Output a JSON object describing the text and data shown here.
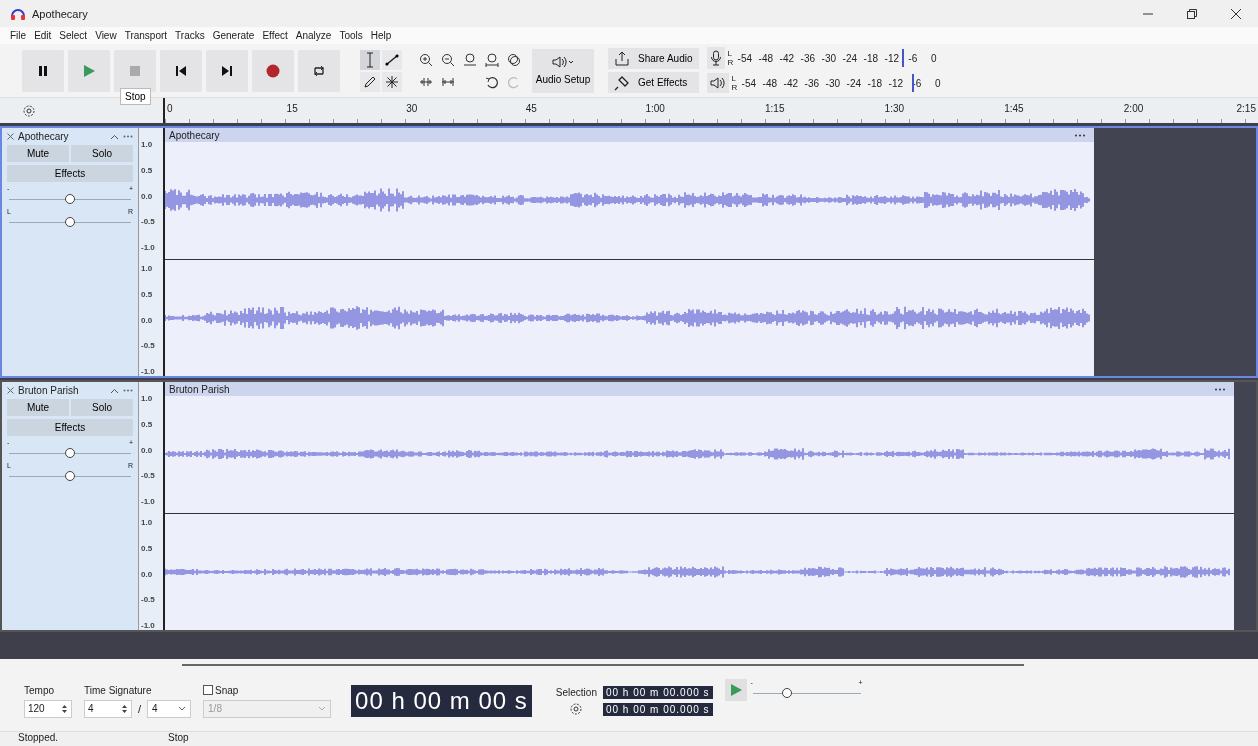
{
  "window": {
    "title": "Apothecary"
  },
  "menu": [
    "File",
    "Edit",
    "Select",
    "View",
    "Transport",
    "Tracks",
    "Generate",
    "Effect",
    "Analyze",
    "Tools",
    "Help"
  ],
  "tooltip": "Stop",
  "audio_setup": "Audio Setup",
  "share_audio": "Share Audio",
  "get_effects": "Get Effects",
  "meters": [
    {
      "kind": "recording",
      "left": "L",
      "right": "R",
      "ticks": [
        "-54",
        "-48",
        "-42",
        "-36",
        "-30",
        "-24",
        "-18",
        "-12",
        "-6",
        "0"
      ],
      "level": 0.79
    },
    {
      "kind": "playback",
      "left": "L",
      "right": "R",
      "ticks": [
        "-54",
        "-48",
        "-42",
        "-36",
        "-30",
        "-24",
        "-18",
        "-12",
        "-6",
        "0"
      ],
      "level": 0.82
    }
  ],
  "timeline": {
    "ticks": [
      "0",
      "15",
      "30",
      "45",
      "1:00",
      "1:15",
      "1:30",
      "1:45",
      "2:00",
      "2:15"
    ]
  },
  "tracks": [
    {
      "name": "Apothecary",
      "selected": true,
      "mute": "Mute",
      "solo": "Solo",
      "effects": "Effects",
      "gain": {
        "minus": "-",
        "plus": "+",
        "level": 0.5
      },
      "pan": {
        "left": "L",
        "right": "R",
        "level": 0.5
      },
      "clip_title": "Apothecary",
      "channels": [
        {
          "scale": [
            "1.0",
            "0.5",
            "0.0",
            "-0.5",
            "-1.0"
          ]
        },
        {
          "scale": [
            "1.0",
            "0.5",
            "0.0",
            "-0.5",
            "-1.0"
          ]
        }
      ]
    },
    {
      "name": "Bruton Parish",
      "selected": false,
      "mute": "Mute",
      "solo": "Solo",
      "effects": "Effects",
      "gain": {
        "minus": "-",
        "plus": "+",
        "level": 0.5
      },
      "pan": {
        "left": "L",
        "right": "R",
        "level": 0.5
      },
      "clip_title": "Bruton Parish",
      "channels": [
        {
          "scale": [
            "1.0",
            "0.5",
            "0.0",
            "-0.5",
            "-1.0"
          ]
        },
        {
          "scale": [
            "1.0",
            "0.5",
            "0.0",
            "-0.5",
            "-1.0"
          ]
        }
      ]
    }
  ],
  "bottom": {
    "tempo_label": "Tempo",
    "tempo": "120",
    "time_signature_label": "Time Signature",
    "beats": "4",
    "separator": "/",
    "unit": "4",
    "snap": {
      "label": "Snap",
      "checked": false,
      "value": "1/8"
    },
    "time": "00 h 00 m 00 s",
    "selection_label": "Selection",
    "selection_start": "00 h 00 m 00.000 s",
    "selection_end": "00 h 00 m 00.000 s",
    "speed": {
      "minus": "-",
      "plus": "+",
      "level": 0.32
    }
  },
  "status_bar": [
    "Stopped.",
    "Stop"
  ]
}
